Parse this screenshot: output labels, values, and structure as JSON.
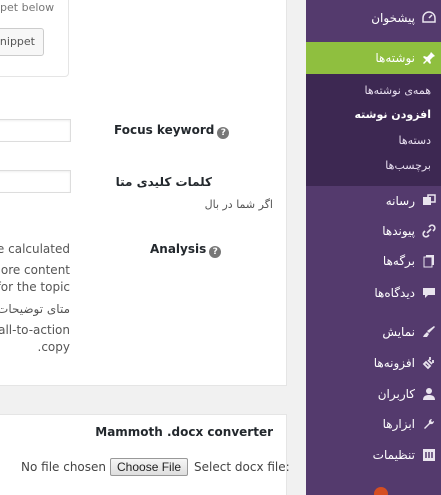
{
  "seo": {
    "snippet_hint": "ippet below",
    "edit_snippet_label": "it snippet",
    "focus_keyword_label": "Focus keyword",
    "meta_keywords_label": "کلمات کلیدی متا",
    "meta_keywords_hint": "اگر شما در بال",
    "analysis_label": "Analysis",
    "help_glyph": "?",
    "analysis_lines": [
      "pe calculated",
      "more content",
      "for the topic",
      "متای توضیحات",
      "call-to-action",
      ".copy"
    ]
  },
  "mammoth": {
    "title": "Mammoth .docx converter",
    "no_file_text": "No file chosen",
    "choose_file_label": "Choose File",
    "select_label": "Select docx file:"
  },
  "sidebar": {
    "accent_color": "#8fbf3f",
    "bg_color": "#543a6d",
    "items": [
      {
        "label": "پیشخوان",
        "icon": "dashboard-icon"
      },
      {
        "label": "نوشته‌ها",
        "icon": "pin-icon"
      },
      {
        "label": "رسانه",
        "icon": "media-icon"
      },
      {
        "label": "پیوندها",
        "icon": "link-icon"
      },
      {
        "label": "برگه‌ها",
        "icon": "pages-icon"
      },
      {
        "label": "دیدگاه‌ها",
        "icon": "comment-icon"
      },
      {
        "label": "نمایش",
        "icon": "appearance-icon"
      },
      {
        "label": "افزونه‌ها",
        "icon": "plugin-icon"
      },
      {
        "label": "کاربران",
        "icon": "users-icon"
      },
      {
        "label": "ابزارها",
        "icon": "tools-icon"
      },
      {
        "label": "تنظیمات",
        "icon": "settings-icon"
      }
    ],
    "submenu": [
      {
        "label": "همه‌ی نوشته‌ها"
      },
      {
        "label": "افزودن نوشته"
      },
      {
        "label": "دسته‌ها"
      },
      {
        "label": "برچسب‌ها"
      }
    ]
  }
}
